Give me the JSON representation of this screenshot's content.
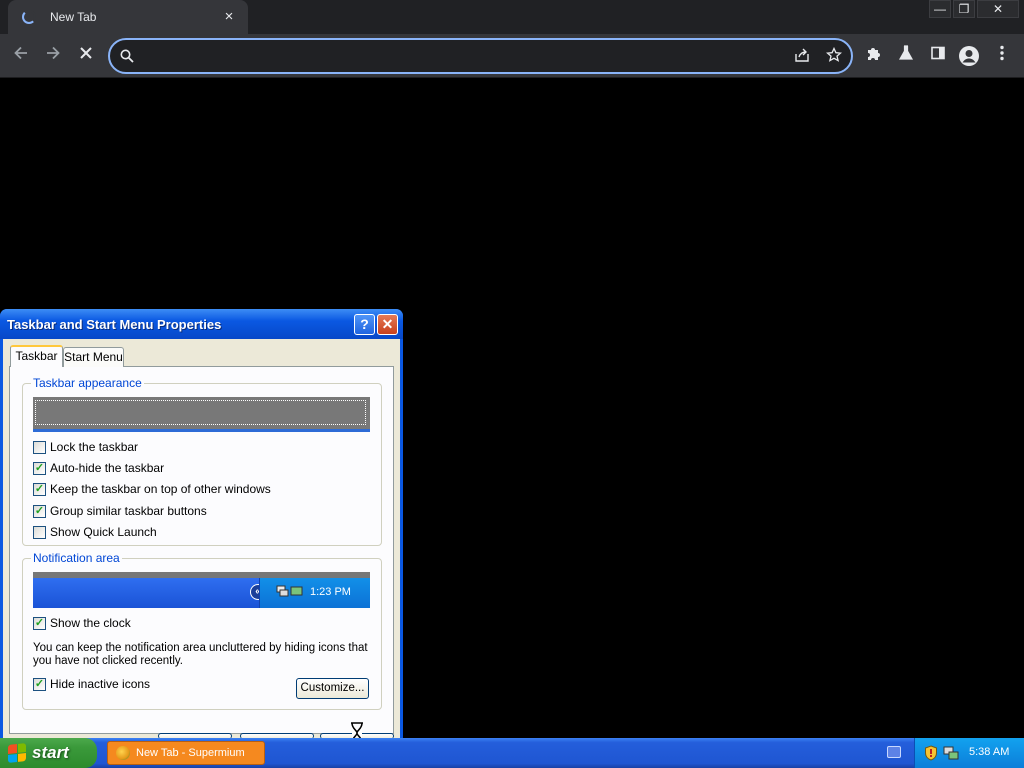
{
  "browser": {
    "tab_title": "New Tab",
    "tab_close": "×",
    "window_controls": {
      "minimize": "—",
      "restore": "❐",
      "close": "✕"
    },
    "omnibox": {
      "value": "",
      "placeholder": ""
    },
    "icons": [
      "back-icon",
      "forward-icon",
      "stop-icon",
      "search-icon",
      "share-icon",
      "star-icon",
      "extensions-icon",
      "labs-icon",
      "sidepanel-icon",
      "profile-icon",
      "menu-icon"
    ]
  },
  "dialog": {
    "title": "Taskbar and Start Menu Properties",
    "help": "?",
    "close": "✕",
    "tabs": [
      {
        "label": "Taskbar",
        "active": true
      },
      {
        "label": "Start Menu",
        "active": false
      }
    ],
    "appearance": {
      "label": "Taskbar appearance",
      "options": [
        {
          "label": "Lock the taskbar",
          "checked": false,
          "mark": ""
        },
        {
          "label": "Auto-hide the taskbar",
          "checked": true,
          "mark": "✓"
        },
        {
          "label": "Keep the taskbar on top of other windows",
          "checked": true,
          "mark": "✓"
        },
        {
          "label": "Group similar taskbar buttons",
          "checked": true,
          "mark": "✓"
        },
        {
          "label": "Show Quick Launch",
          "checked": false,
          "mark": ""
        }
      ]
    },
    "notification": {
      "label": "Notification area",
      "preview_time": "1:23 PM",
      "show_clock": {
        "label": "Show the clock",
        "checked": true,
        "mark": "✓"
      },
      "description": "You can keep the notification area uncluttered by hiding icons that you have not clicked recently.",
      "hide_inactive": {
        "label": "Hide inactive icons",
        "checked": true,
        "mark": "✓"
      },
      "customize_button": "Customize..."
    }
  },
  "taskbar": {
    "start_label": "start",
    "task_button": "New Tab - Supermium",
    "clock": "5:38 AM"
  },
  "colors": {
    "xp_blue": "#0a58e2",
    "start_green": "#3b9a3b",
    "task_orange": "#f5891f",
    "focus_ring": "#8ab4f8"
  }
}
